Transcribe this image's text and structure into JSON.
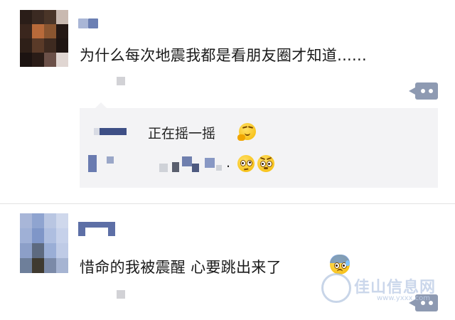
{
  "posts": [
    {
      "text": "为什么每次地震我都是看朋友圈才知道......",
      "author_hidden": true,
      "comment": {
        "text": "正在摇一摇",
        "emoji_after_text": "thinking-hand-face",
        "second_line_emojis": [
          "dizzy-face",
          "flushed-face"
        ],
        "second_line_dot": "."
      }
    },
    {
      "text": "惜命的我被震醒 心要跳出来了",
      "emoji": "anxious-sweat-face",
      "author_hidden": true
    }
  ],
  "watermark": {
    "text": "佳山信息网",
    "sub": "www.yxxx.com"
  },
  "colors": {
    "more_button": "#8e9ab2",
    "comment_bg": "#f3f3f5",
    "divider": "#e3e3e3"
  }
}
